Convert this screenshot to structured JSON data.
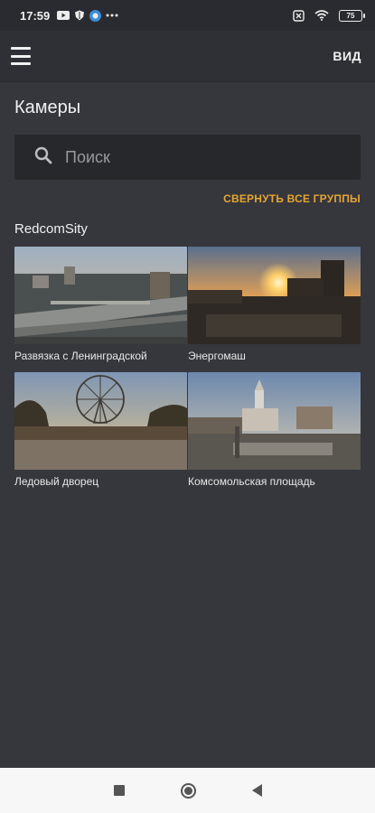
{
  "status_bar": {
    "time": "17:59",
    "battery": "75",
    "icons": [
      "youtube-icon",
      "shield-icon",
      "app-icon",
      "more-dots-icon",
      "sim-off-icon",
      "wifi-icon",
      "battery-icon"
    ]
  },
  "app_bar": {
    "view_label": "ВИД"
  },
  "page": {
    "title": "Камеры"
  },
  "search": {
    "placeholder": "Поиск"
  },
  "collapse_all": "СВЕРНУТЬ ВСЕ ГРУППЫ",
  "group": {
    "name": "RedcomSity",
    "cameras": [
      {
        "label": "Развязка с Ленинградской"
      },
      {
        "label": "Энергомаш"
      },
      {
        "label": "Ледовый дворец"
      },
      {
        "label": "Комсомольская площадь"
      }
    ]
  },
  "colors": {
    "background": "#35373d",
    "accent": "#e6a431",
    "search_bg": "#26282c"
  }
}
